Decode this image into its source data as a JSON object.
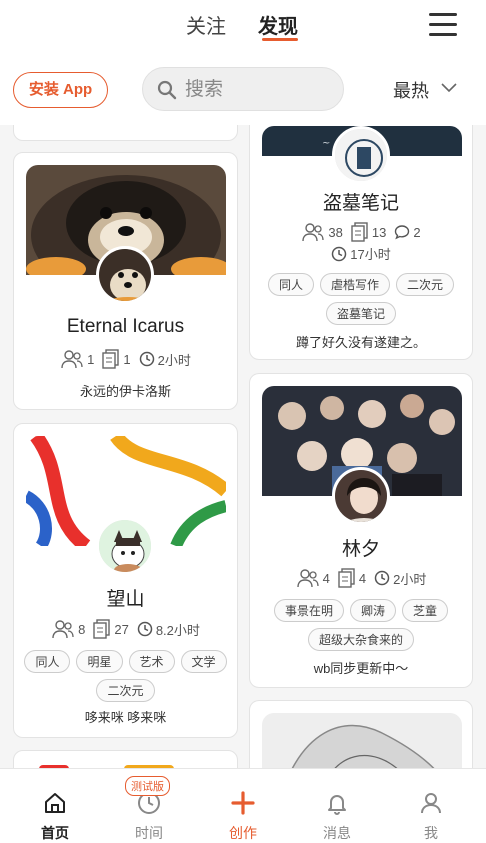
{
  "header": {
    "tabs": [
      {
        "label": "关注"
      },
      {
        "label": "发现",
        "active": true
      }
    ]
  },
  "toolbar": {
    "install_label": "安装 App",
    "search_placeholder": "搜索",
    "sort_label": "最热"
  },
  "cards": [
    {
      "title": "Eternal Icarus",
      "stats": {
        "members": "1",
        "posts": "1",
        "time": "2小时"
      },
      "tags": [],
      "description": "永远的伊卡洛斯"
    },
    {
      "title": "望山",
      "stats": {
        "members": "8",
        "posts": "27",
        "time": "8.2小时"
      },
      "tags": [
        "同人",
        "明星",
        "艺术",
        "文学",
        "二次元"
      ],
      "description": "哆来咪 哆来咪"
    },
    {
      "title": "盗墓笔记",
      "stats": {
        "members": "38",
        "posts": "13",
        "comments": "2",
        "time": "17小时"
      },
      "tags": [
        "同人",
        "虐梏写作",
        "二次元",
        "盗墓笔记"
      ],
      "description": "蹲了好久没有遂建之。"
    },
    {
      "title": "林夕",
      "stats": {
        "members": "4",
        "posts": "4",
        "time": "2小时"
      },
      "tags": [
        "事景在明",
        "卿涛",
        "芝童",
        "超级大杂食来的"
      ],
      "description": "wb同步更新中～"
    }
  ],
  "bottom_nav": {
    "beta_badge": "测试版",
    "items": [
      {
        "label": "首页",
        "icon": "home-icon",
        "active": true
      },
      {
        "label": "时间",
        "icon": "clock-icon"
      },
      {
        "label": "创作",
        "icon": "plus-icon"
      },
      {
        "label": "消息",
        "icon": "bell-icon"
      },
      {
        "label": "我",
        "icon": "user-icon"
      }
    ]
  },
  "colors": {
    "accent": "#e65c2f",
    "text": "#222222",
    "muted": "#888888"
  }
}
